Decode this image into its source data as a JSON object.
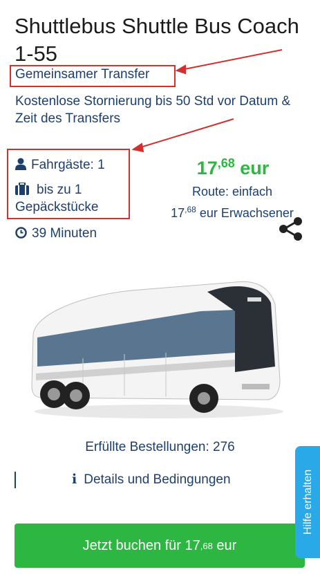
{
  "title": "Shuttlebus Shuttle Bus Coach 1-55",
  "subtitle": "Gemeinsamer Transfer",
  "cancellation": "Kostenlose Stornierung bis 50 Std vor Datum & Zeit des Transfers",
  "features": {
    "passengers": "Fahrgäste: 1",
    "luggage_line1": "bis zu 1",
    "luggage_line2": "Gepäckstücke",
    "duration": "39 Minuten"
  },
  "price": {
    "whole": "17",
    "cents": "68",
    "currency": "eur"
  },
  "route": {
    "type": "Route: einfach",
    "per_adult_whole": "17",
    "per_adult_cents": "68",
    "per_adult_suffix": "eur Erwachsener"
  },
  "orders": "Erfüllte Bestellungen: 276",
  "details": "Details und Bedingungen",
  "book": {
    "prefix": "Jetzt buchen für 17",
    "cents": "68",
    "suffix": "eur"
  },
  "help": "Hilfe erhalten",
  "colors": {
    "accent_green": "#2db742",
    "text_blue": "#1d3f6e",
    "help_blue": "#29a9e8",
    "annotation_red": "#d32f2f"
  },
  "icons": [
    "user-icon",
    "suitcase-icon",
    "clock-icon",
    "share-icon",
    "info-icon"
  ]
}
